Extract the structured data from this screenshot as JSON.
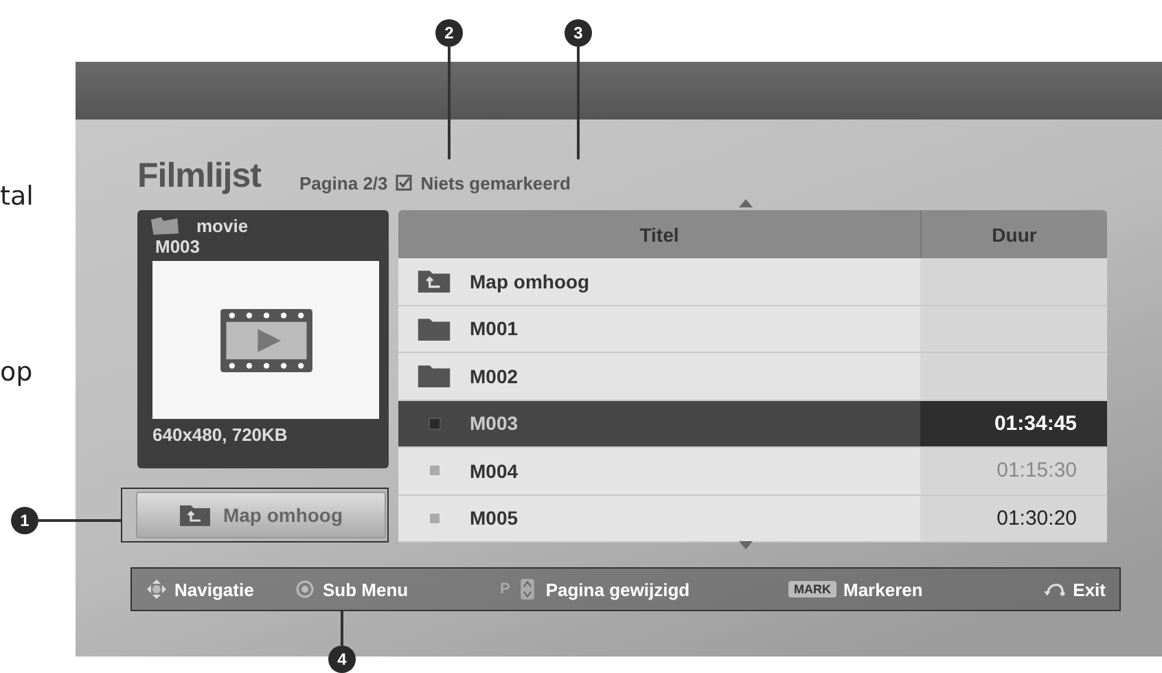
{
  "margin_texts": [
    "tal",
    "op"
  ],
  "callouts": [
    "2",
    "3",
    "1",
    "4"
  ],
  "screen": {
    "title": "Filmlijst",
    "page": "Pagina 2/3",
    "mark_status": "Niets gemarkeerd",
    "preview": {
      "folder": "movie",
      "file": "M003",
      "info": "640x480, 720KB"
    },
    "up_button": "Map omhoog",
    "table": {
      "columns": [
        "Titel",
        "Duur"
      ],
      "rows": [
        {
          "kind": "up",
          "title": "Map omhoog",
          "selected": false
        },
        {
          "kind": "folder",
          "title": "M001",
          "selected": false
        },
        {
          "kind": "folder",
          "title": "M002",
          "selected": false
        },
        {
          "kind": "file",
          "title": "M003",
          "duration": "01:34:45",
          "selected": true,
          "dimmed": false
        },
        {
          "kind": "file",
          "title": "M004",
          "duration": "01:15:30",
          "selected": false,
          "dimmed": true
        },
        {
          "kind": "file",
          "title": "M005",
          "duration": "01:30:20",
          "selected": false,
          "dimmed": false
        }
      ]
    },
    "help_bar": [
      {
        "kind": "nav",
        "label": "Navigatie"
      },
      {
        "kind": "ok",
        "label": "Sub Menu"
      },
      {
        "kind": "page",
        "key": "P",
        "label": "Pagina gewijzigd"
      },
      {
        "kind": "mark",
        "key": "MARK",
        "label": "Markeren"
      },
      {
        "kind": "exit",
        "label": "Exit"
      }
    ]
  }
}
